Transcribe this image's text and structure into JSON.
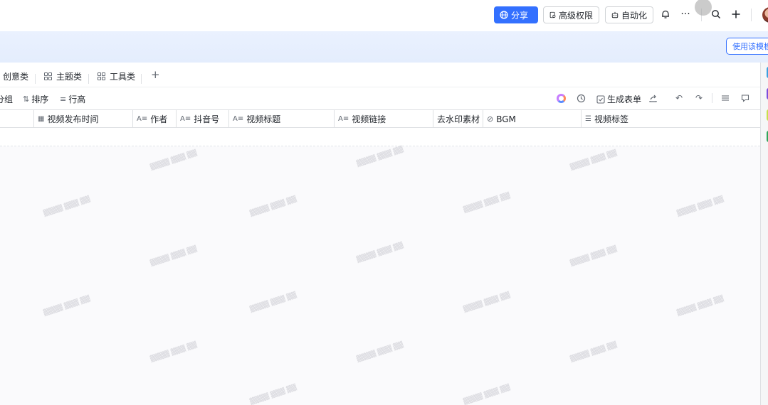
{
  "topbar": {
    "share_label": "分享",
    "permission_label": "高级权限",
    "automation_label": "自动化",
    "more_label": "···"
  },
  "banner": {
    "button_label": "使用该模板"
  },
  "tabs": [
    {
      "label": "创意类"
    },
    {
      "label": "主题类"
    },
    {
      "label": "工具类"
    }
  ],
  "toolbar": {
    "group_label": "分组",
    "sort_label": "排序",
    "row_height_label": "行高",
    "generate_form_label": "生成表单"
  },
  "columns": [
    {
      "label": "视频发布时间",
      "icon": "calendar-icon"
    },
    {
      "label": "作者",
      "icon": "text-icon"
    },
    {
      "label": "抖音号",
      "icon": "text-icon"
    },
    {
      "label": "视频标题",
      "icon": "text-icon"
    },
    {
      "label": "视频链接",
      "icon": "text-icon"
    },
    {
      "label": "去水印素材",
      "icon": "none"
    },
    {
      "label": "BGM",
      "icon": "attachment-icon"
    },
    {
      "label": "视频标签",
      "icon": "list-icon"
    }
  ],
  "colors": {
    "primary": "#3370ff",
    "banner_bg": "#e4edfd",
    "border": "#dee0e3"
  }
}
